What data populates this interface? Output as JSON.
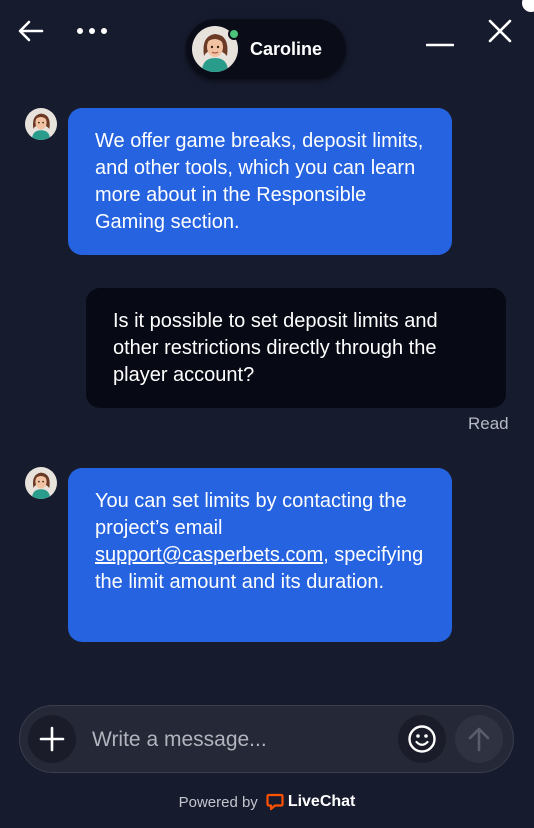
{
  "header": {
    "back_icon": "arrow-left-icon",
    "more_icon": "more-horizontal-icon",
    "agent_name": "Caroline",
    "agent_status_color": "#4bc37a",
    "minimize_icon": "minimize-icon",
    "close_icon": "close-icon"
  },
  "messages": [
    {
      "from": "agent",
      "text": "We offer game breaks, deposit limits, and other tools, which you can learn more about in the Responsible Gaming section."
    },
    {
      "from": "user",
      "text": "Is it possible to set deposit limits and other restrictions directly through the player account?",
      "status": "Read"
    },
    {
      "from": "agent",
      "text_before": "You can set limits by contacting the project’s email ",
      "link": "support@casperbets.com",
      "text_after": ", specifying the limit amount and its duration."
    }
  ],
  "composer": {
    "placeholder": "Write a message...",
    "value": ""
  },
  "footer": {
    "powered_by": "Powered by",
    "brand": "LiveChat",
    "brand_color": "#ff5100"
  },
  "colors": {
    "background": "#161b2e",
    "agent_bubble": "#2563e0",
    "user_bubble": "#070a14"
  }
}
